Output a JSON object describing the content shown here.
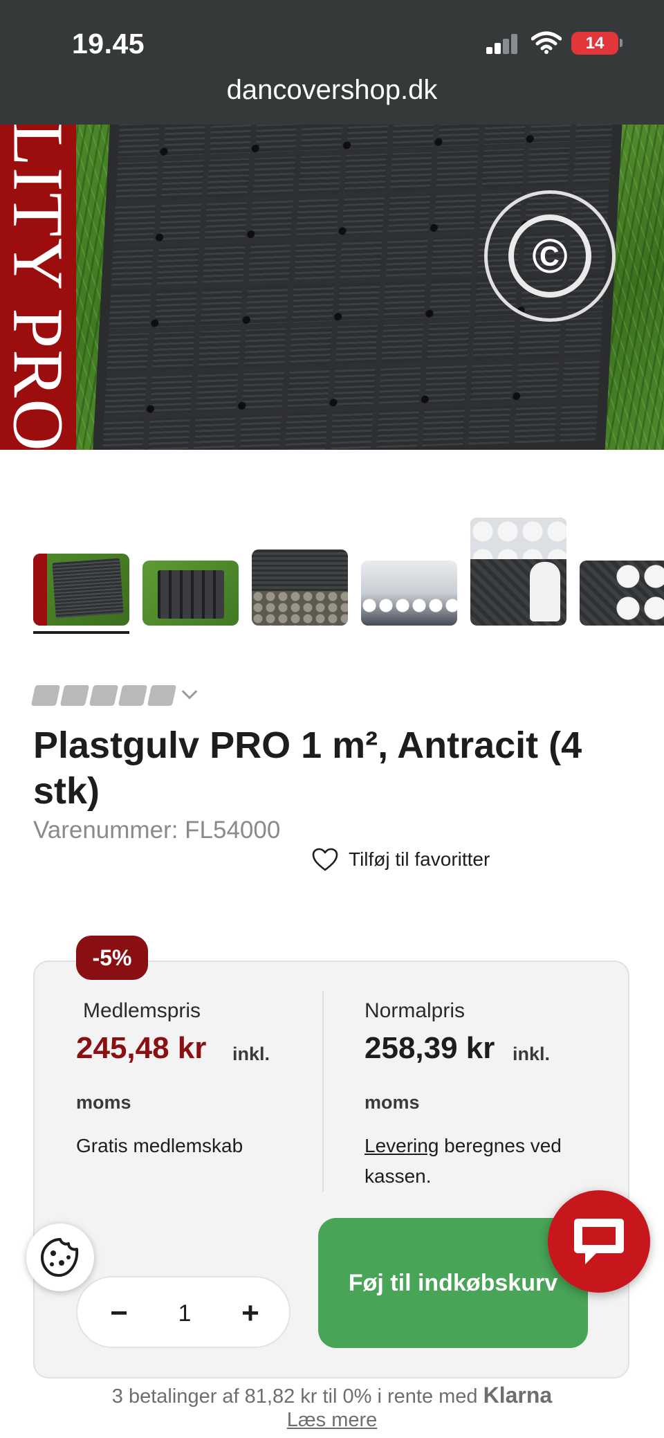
{
  "status_bar": {
    "time": "19.45",
    "battery": "14"
  },
  "browser": {
    "url": "dancovershop.dk"
  },
  "hero": {
    "brand_band_text": "LITY PRO"
  },
  "thumbnails": [
    {
      "name": "Plastgulv PRO grass"
    },
    {
      "name": "Plastgulv PRO underside"
    },
    {
      "name": "Plastgulv PRO gravel"
    },
    {
      "name": "Tent floor event"
    },
    {
      "name": "Floor with chairs"
    },
    {
      "name": "Floor with chairs 2"
    }
  ],
  "product": {
    "title": "Plastgulv PRO 1 m², Antracit (4 stk)",
    "sku": "Varenummer: FL54000",
    "favorite_label": "Tilføj til favoritter"
  },
  "pricing": {
    "discount_badge": "-5%",
    "member": {
      "label": "Medlemspris",
      "price": "245,48 kr",
      "incl": "inkl.",
      "moms": "moms",
      "note": "Gratis medlemskab"
    },
    "normal": {
      "label": "Normalpris",
      "price": "258,39 kr",
      "incl": "inkl.",
      "moms": "moms",
      "delivery_link": "Levering",
      "delivery_text": " beregnes ved kassen."
    }
  },
  "cart": {
    "quantity": "1",
    "minus": "−",
    "plus": "+",
    "add_label": "Føj til indkøbskurv"
  },
  "klarna": {
    "text": "3 betalinger af 81,82 kr til 0% i rente med ",
    "brand": "Klarna",
    "more": "Læs mere"
  },
  "colors": {
    "brand_red": "#8a0f12",
    "cta_green": "#48a457",
    "chat_red": "#c8161d",
    "topbar": "#36393a"
  },
  "icons": [
    "signal-icon",
    "wifi-icon",
    "battery-icon",
    "heart-icon",
    "cookie-icon",
    "chat-icon",
    "chevron-down-icon"
  ]
}
